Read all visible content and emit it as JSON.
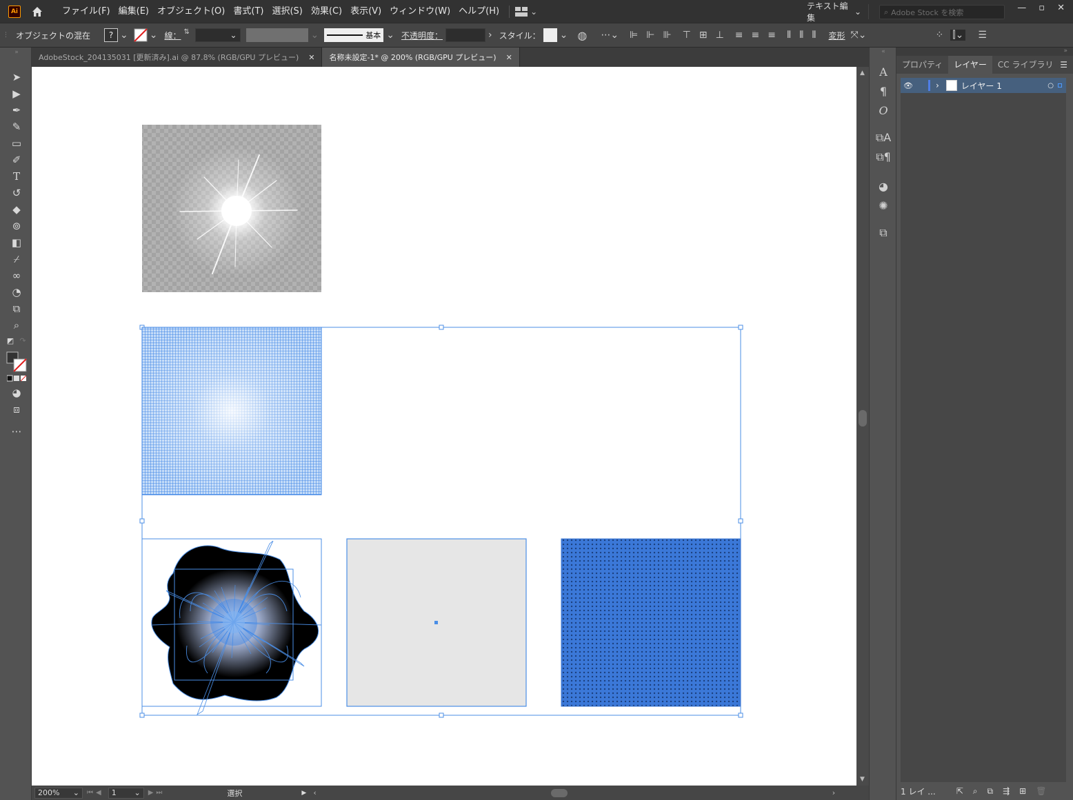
{
  "app": {
    "logo": "Ai"
  },
  "menu": {
    "items": [
      "ファイル(F)",
      "編集(E)",
      "オブジェクト(O)",
      "書式(T)",
      "選択(S)",
      "効果(C)",
      "表示(V)",
      "ウィンドウ(W)",
      "ヘルプ(H)"
    ],
    "workspace": "テキスト編集",
    "search_placeholder": "Adobe Stock を検索"
  },
  "control": {
    "object_label": "オブジェクトの混在",
    "stroke_label": "線：",
    "stroke_style": "基本",
    "opacity_label": "不透明度：",
    "style_label": "スタイル：",
    "transform_label": "変形"
  },
  "tabs": [
    {
      "label": "AdobeStock_204135031 [更新済み].ai @ 87.8% (RGB/GPU プレビュー)",
      "active": false
    },
    {
      "label": "名称未設定-1* @ 200% (RGB/GPU プレビュー)",
      "active": true
    }
  ],
  "status": {
    "zoom": "200%",
    "page": "1",
    "tool": "選択"
  },
  "panel": {
    "tabs": [
      "プロパティ",
      "レイヤー",
      "CC ライブラリ"
    ],
    "active_tab": "レイヤー",
    "layer_name": "レイヤー 1",
    "footer": "1 レイ ..."
  },
  "colors": {
    "selection": "#4a8ee6",
    "pattern_fill": "#3b78d8",
    "canvas": "#ffffff"
  }
}
